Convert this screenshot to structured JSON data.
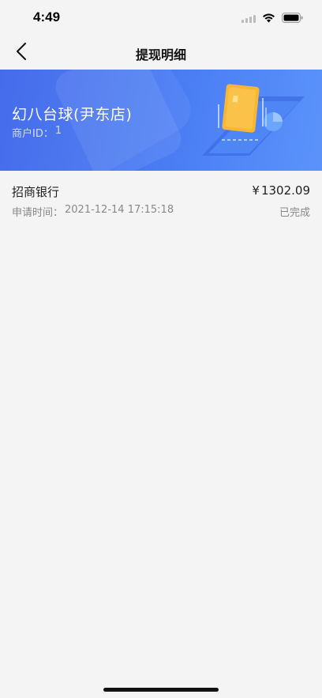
{
  "status_bar": {
    "time": "4:49",
    "icons": [
      "signal-icon",
      "wifi-icon",
      "battery-icon"
    ]
  },
  "nav": {
    "back_icon": "chevron-left-icon",
    "title": "提现明细"
  },
  "banner": {
    "shop_name": "幻八台球(尹东店)",
    "merchant_id_label": "商户ID：",
    "merchant_id_value": "1",
    "colors": {
      "start": "#3a63ea",
      "end": "#5b93fa"
    }
  },
  "records": [
    {
      "bank": "招商银行",
      "amount_prefix": "¥",
      "amount": "1302.09",
      "apply_time_label": "申请时间：",
      "apply_time": "2021-12-14 17:15:18",
      "status": "已完成"
    }
  ]
}
